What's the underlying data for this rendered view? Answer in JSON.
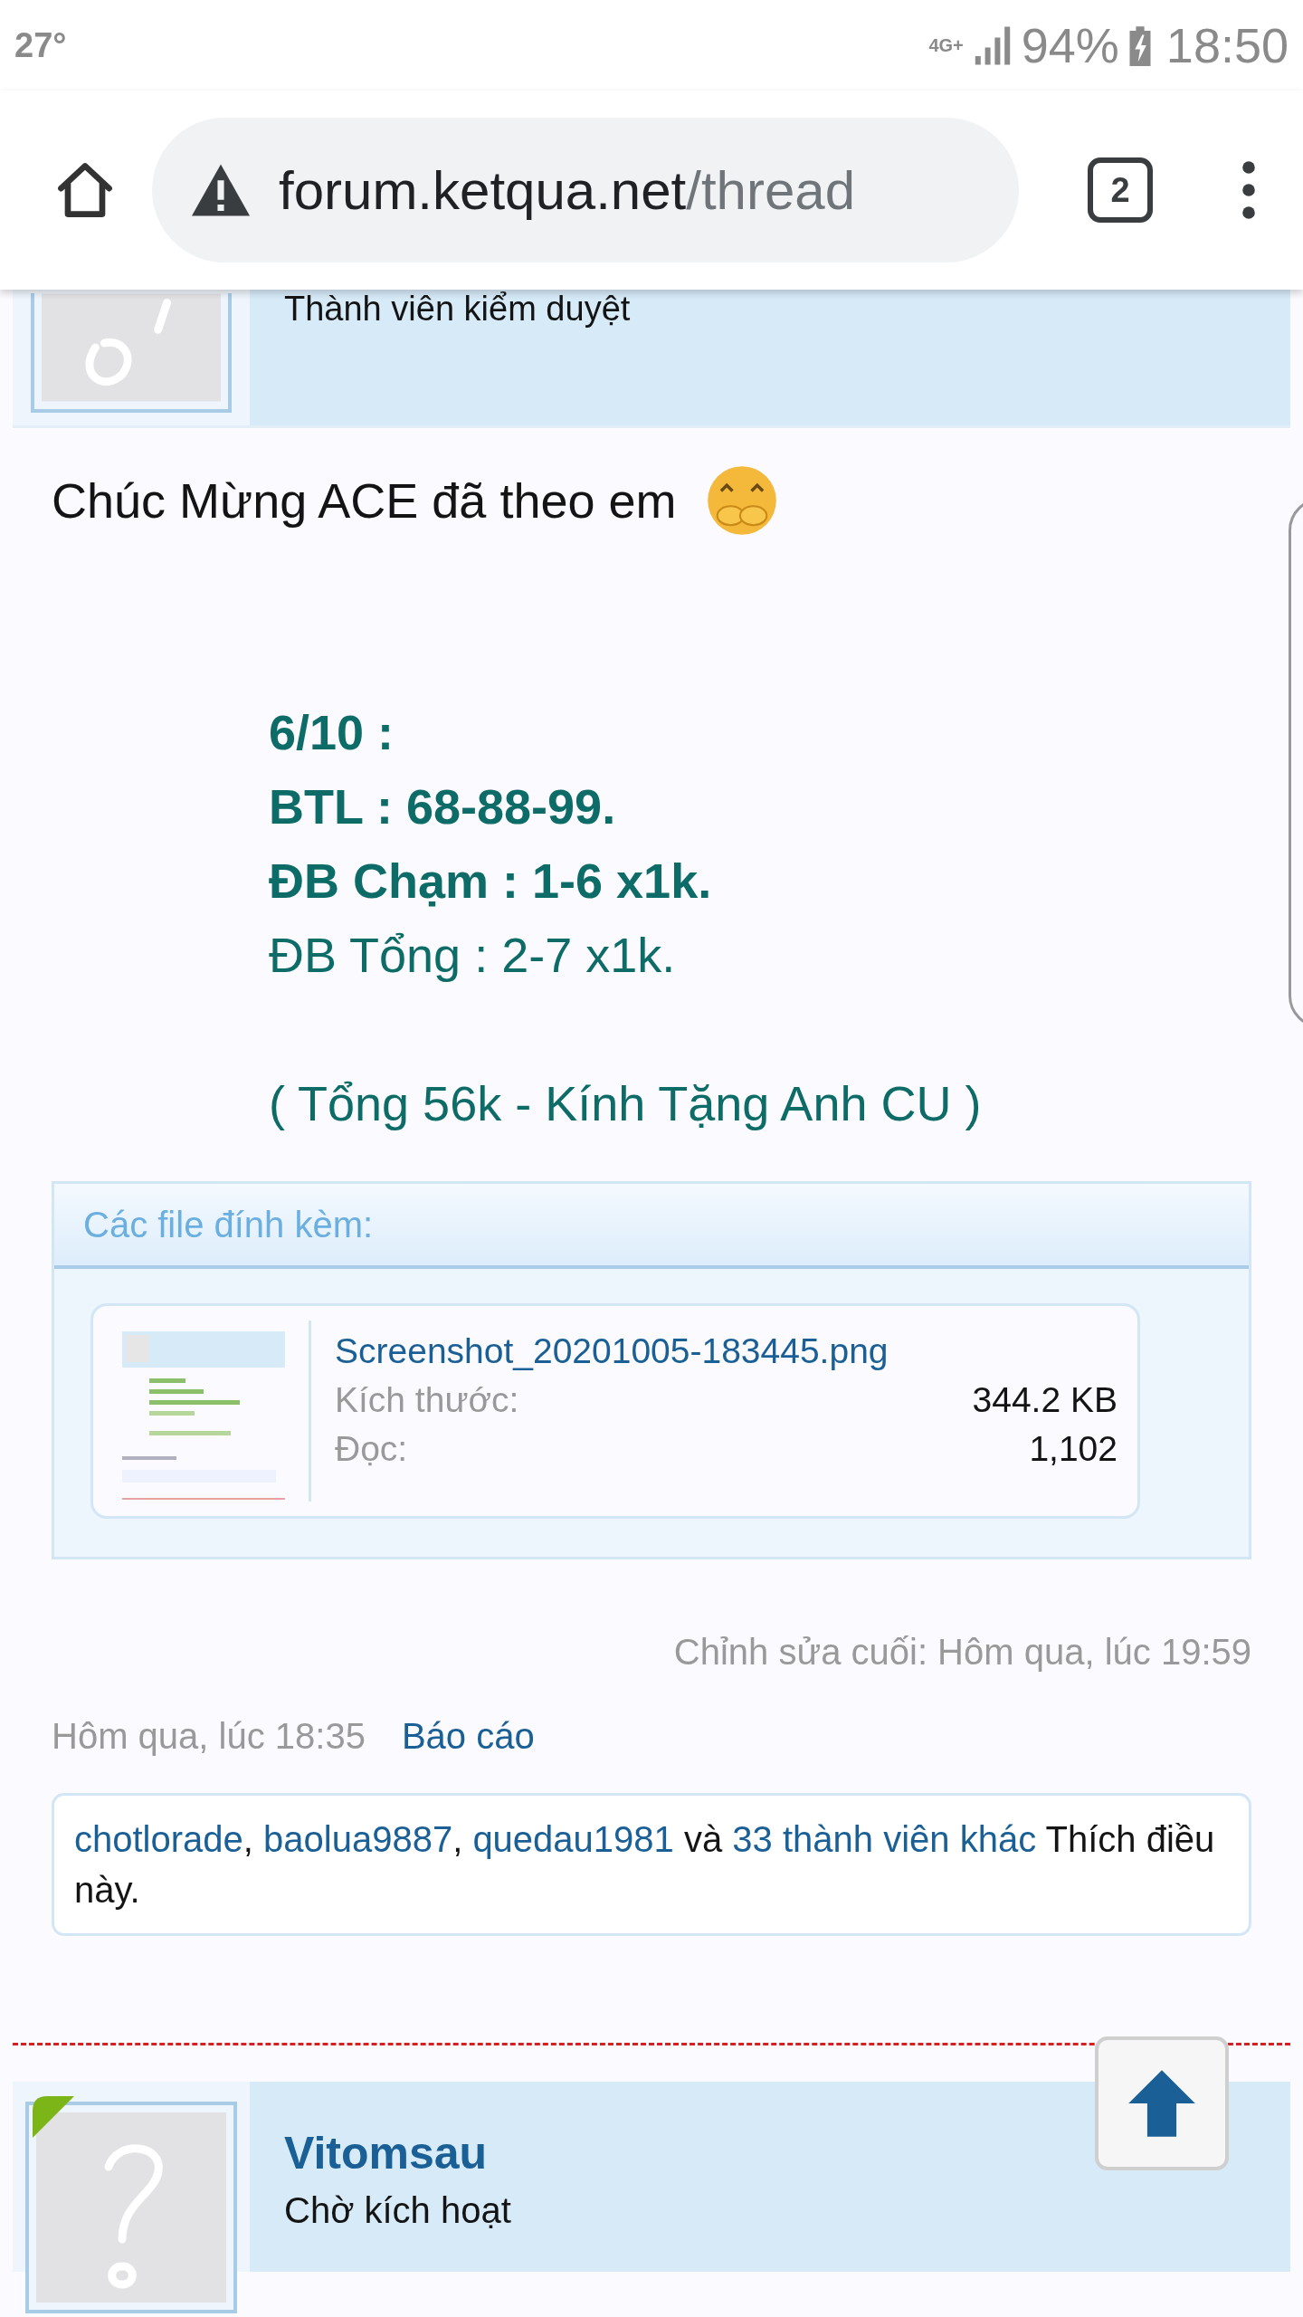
{
  "status_bar": {
    "temperature": "27°",
    "network": "4G+",
    "battery": "94%",
    "time": "18:50"
  },
  "browser": {
    "url_host": "forum.ketqua.net",
    "url_path": "/thread",
    "tab_count": "2"
  },
  "previous_post": {
    "user_title": "Thành viên kiểm duyệt"
  },
  "post": {
    "greeting": "Chúc Mừng ACE đã theo em",
    "lines": [
      {
        "text": "6/10 :",
        "kind": "bold"
      },
      {
        "text": "BTL : 68-88-99.",
        "kind": "bold"
      },
      {
        "text": "ĐB Chạm : 1-6 x1k.",
        "kind": "bold"
      },
      {
        "text": "ĐB Tổng : 2-7 x1k.",
        "kind": "normal"
      },
      {
        "text": "( Tổng 56k - Kính Tặng Anh CU )",
        "kind": "note"
      }
    ],
    "attachments": {
      "title": "Các file đính kèm:",
      "files": [
        {
          "name": "Screenshot_20201005-183445.png",
          "size_label": "Kích thước:",
          "size": "344.2 KB",
          "views_label": "Đọc:",
          "views": "1,102"
        }
      ]
    },
    "edited": "Chỉnh sửa cuối: Hôm qua, lúc 19:59",
    "date": "Hôm qua, lúc 18:35",
    "report": "Báo cáo",
    "likes": {
      "users": [
        {
          "name": "chotlorade",
          "after": ","
        },
        {
          "name": "baolua9887",
          "after": ","
        },
        {
          "name": "quedau1981"
        }
      ],
      "and": "và",
      "others": "33 thành viên khác",
      "suffix": "Thích điều này."
    }
  },
  "next_post": {
    "username": "Vitomsau",
    "user_title": "Chờ kích hoạt",
    "online": true
  }
}
